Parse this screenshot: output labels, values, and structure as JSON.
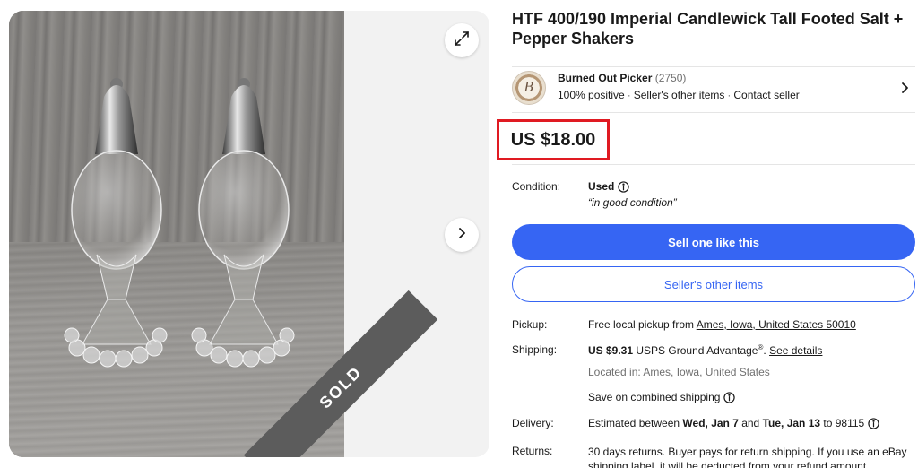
{
  "gallery": {
    "sold_label": "SOLD",
    "icons": {
      "expand": "expand-icon",
      "next": "chevron-right-icon"
    }
  },
  "listing": {
    "title": "HTF 400/190 Imperial Candlewick Tall Footed Salt + Pepper Shakers",
    "price": "US $18.00"
  },
  "seller": {
    "name": "Burned Out Picker",
    "feedback_count": "(2750)",
    "positive": "100% positive",
    "other_items_link": "Seller's other items",
    "contact_link": "Contact seller",
    "avatar_monogram": "B"
  },
  "condition": {
    "label": "Condition:",
    "value": "Used",
    "note": "“in good condition”"
  },
  "actions": {
    "sell_one": "Sell one like this",
    "other_items": "Seller's other items"
  },
  "pickup": {
    "label": "Pickup:",
    "prefix": "Free local pickup from ",
    "location": "Ames, Iowa, United States 50010"
  },
  "shipping": {
    "label": "Shipping:",
    "cost": "US $9.31",
    "service": " USPS Ground Advantage",
    "reg": "®",
    "sep": ". ",
    "details_link": "See details",
    "located": "Located in: Ames, Iowa, United States",
    "combined": "Save on combined shipping"
  },
  "delivery": {
    "label": "Delivery:",
    "prefix": "Estimated between ",
    "start": "Wed, Jan 7",
    "and": " and ",
    "end": "Tue, Jan 13",
    "suffix": " to 98115"
  },
  "returns": {
    "label": "Returns:",
    "text": "30 days returns. Buyer pays for return shipping. If you use an eBay shipping label, it will be deducted from your refund amount."
  },
  "colors": {
    "accent": "#3665f3",
    "highlight": "#e01a22",
    "sold_ribbon": "#5c5c5c"
  }
}
